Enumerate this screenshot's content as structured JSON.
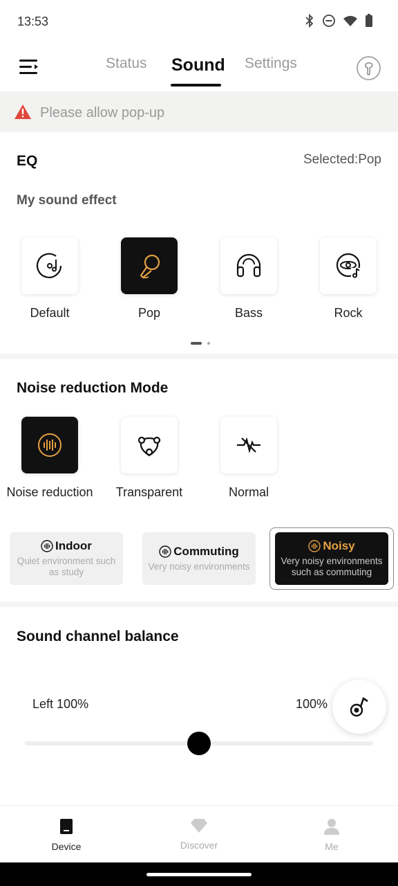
{
  "status_bar": {
    "time": "13:53",
    "icons": [
      "bluetooth-icon",
      "do-not-disturb-icon",
      "wifi-icon",
      "battery-icon"
    ]
  },
  "header": {
    "tabs": [
      {
        "label": "Status",
        "active": false
      },
      {
        "label": "Sound",
        "active": true
      },
      {
        "label": "Settings",
        "active": false
      }
    ]
  },
  "warning": {
    "text": "Please allow pop-up",
    "icon": "warning-icon",
    "color": "#e0473c"
  },
  "eq": {
    "title": "EQ",
    "selected": "Selected:Pop",
    "subtitle": "My sound effect",
    "items": [
      {
        "label": "Default",
        "icon": "music-disc-icon",
        "active": false
      },
      {
        "label": "Pop",
        "icon": "microphone-icon",
        "active": true
      },
      {
        "label": "Bass",
        "icon": "headphones-icon",
        "active": false
      },
      {
        "label": "Rock",
        "icon": "rock-disc-icon",
        "active": false
      }
    ],
    "page_indicator": {
      "current": 1,
      "total": 2
    }
  },
  "noise": {
    "title": "Noise reduction Mode",
    "items": [
      {
        "label": "Noise reduction",
        "icon": "sound-wave-icon",
        "active": true
      },
      {
        "label": "Transparent",
        "icon": "transparent-icon",
        "active": false
      },
      {
        "label": "Normal",
        "icon": "normal-off-icon",
        "active": false
      }
    ],
    "modes": [
      {
        "title": "Indoor",
        "desc": "Quiet environment such as study",
        "active": false
      },
      {
        "title": "Commuting",
        "desc": "Very noisy environments",
        "active": false
      },
      {
        "title": "Noisy",
        "desc": "Very noisy environments such as commuting",
        "active": true
      }
    ],
    "accent_color": "#e5a043"
  },
  "balance": {
    "title": "Sound channel balance",
    "left_label": "Left",
    "left_value": "100%",
    "right_value": "100%",
    "position": 0.5
  },
  "bottom_nav": [
    {
      "label": "Device",
      "icon": "device-icon",
      "active": true
    },
    {
      "label": "Discover",
      "icon": "diamond-icon",
      "active": false
    },
    {
      "label": "Me",
      "icon": "person-icon",
      "active": false
    }
  ]
}
